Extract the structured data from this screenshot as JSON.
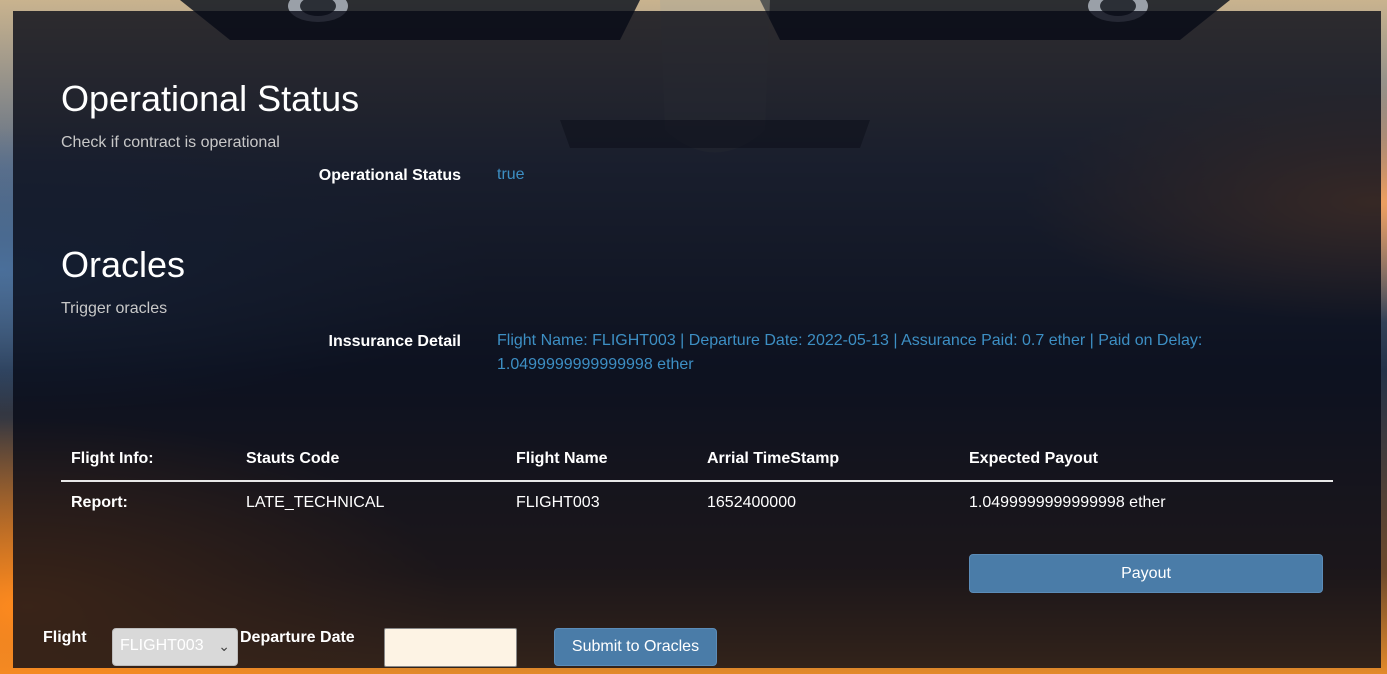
{
  "operational": {
    "title": "Operational Status",
    "subtitle": "Check if contract is operational",
    "label": "Operational Status",
    "value": "true"
  },
  "oracles": {
    "title": "Oracles",
    "subtitle": "Trigger oracles",
    "label": "Inssurance Detail",
    "detail": "Flight Name: FLIGHT003 | Departure Date: 2022-05-13 | Assurance Paid: 0.7 ether | Paid on Delay: 1.0499999999999998 ether"
  },
  "report_table": {
    "headers": [
      "Flight Info:",
      "Stauts Code",
      "Flight Name",
      "Arrial TimeStamp",
      "Expected Payout"
    ],
    "rows": [
      [
        "Report:",
        "LATE_TECHNICAL",
        "FLIGHT003",
        "1652400000",
        "1.0499999999999998 ether"
      ]
    ]
  },
  "payout_button": "Payout",
  "form": {
    "flight_label": "Flight",
    "flight_selected": "FLIGHT003",
    "departure_label": "Departure Date",
    "departure_value": "",
    "submit_label": "Submit to Oracles"
  }
}
